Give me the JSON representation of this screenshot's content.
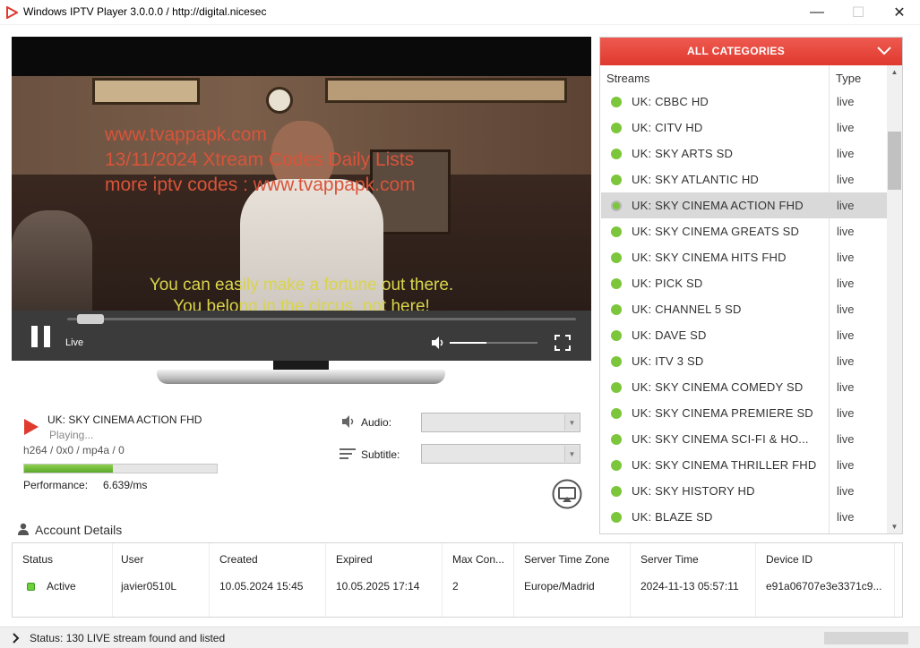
{
  "window": {
    "title": "Windows IPTV Player 3.0.0.0 / http://digital.nicesec",
    "minimize": "—",
    "maximize": "☐",
    "close": "✕"
  },
  "player": {
    "watermark_lines": [
      "www.tvappapk.com",
      "13/11/2024 Xtream Codes Daily Lists",
      "more iptv codes : www.tvappapk.com"
    ],
    "subtitle_lines": [
      "You can easily make a fortune out there.",
      "You belong in the circus, not here!"
    ],
    "live_label": "Live",
    "volume_level": 0.42,
    "seek_position": 0.02
  },
  "now_playing": {
    "title": "UK: SKY CINEMA ACTION FHD",
    "status": "Playing...",
    "codec": "h264 / 0x0 / mp4a / 0",
    "performance_level": 0.46,
    "performance_label": "Performance:",
    "performance_value": "6.639/ms",
    "audio_label": "Audio:",
    "subtitle_label": "Subtitle:"
  },
  "streams": {
    "category": "ALL CATEGORIES",
    "col_streams": "Streams",
    "col_type": "Type",
    "items": [
      {
        "name": "UK: CBBC HD",
        "type": "live"
      },
      {
        "name": "UK: CITV HD",
        "type": "live"
      },
      {
        "name": "UK: SKY ARTS SD",
        "type": "live"
      },
      {
        "name": "UK: SKY ATLANTIC HD",
        "type": "live"
      },
      {
        "name": "UK: SKY CINEMA ACTION FHD",
        "type": "live",
        "selected": true
      },
      {
        "name": "UK: SKY CINEMA GREATS SD",
        "type": "live"
      },
      {
        "name": "UK: SKY CINEMA HITS FHD",
        "type": "live"
      },
      {
        "name": "UK: PICK SD",
        "type": "live"
      },
      {
        "name": "UK: CHANNEL 5 SD",
        "type": "live"
      },
      {
        "name": "UK: DAVE SD",
        "type": "live"
      },
      {
        "name": "UK: ITV 3 SD",
        "type": "live"
      },
      {
        "name": "UK: SKY CINEMA COMEDY SD",
        "type": "live"
      },
      {
        "name": "UK: SKY CINEMA PREMIERE SD",
        "type": "live"
      },
      {
        "name": "UK: SKY CINEMA SCI-FI & HO...",
        "type": "live"
      },
      {
        "name": "UK: SKY CINEMA THRILLER FHD",
        "type": "live"
      },
      {
        "name": "UK: SKY HISTORY HD",
        "type": "live"
      },
      {
        "name": "UK: BLAZE SD",
        "type": "live"
      }
    ],
    "status_color": "#7cc63b"
  },
  "account": {
    "title": "Account Details",
    "columns": [
      {
        "header": "Status",
        "value": "Active"
      },
      {
        "header": "User",
        "value": "javier0510L"
      },
      {
        "header": "Created",
        "value": "10.05.2024 15:45"
      },
      {
        "header": "Expired",
        "value": "10.05.2025 17:14"
      },
      {
        "header": "Max Con...",
        "value": "2"
      },
      {
        "header": "Server Time Zone",
        "value": "Europe/Madrid"
      },
      {
        "header": "Server Time",
        "value": "2024-11-13 05:57:11"
      },
      {
        "header": "Device ID",
        "value": "e91a06707e3e3371c9..."
      }
    ]
  },
  "statusbar": {
    "text": "Status: 130 LIVE stream found and listed"
  },
  "colors": {
    "accent": "#e0392e",
    "live_dot": "#7cc63b",
    "performance": "#5aa82a"
  }
}
